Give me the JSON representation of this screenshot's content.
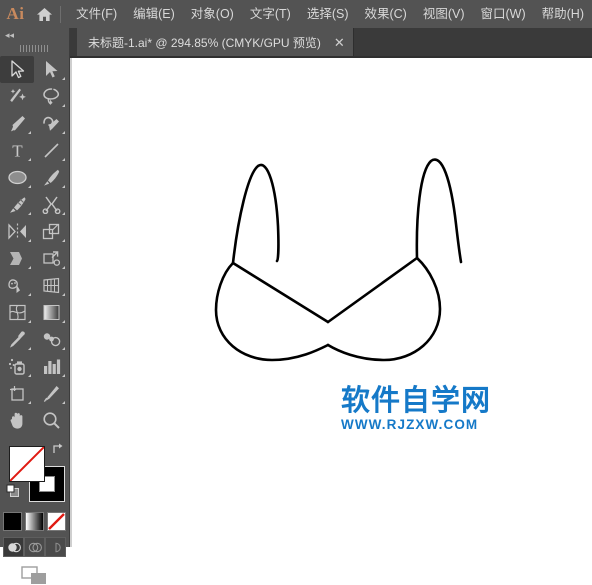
{
  "app": {
    "logo": "Ai",
    "home_icon": "home-icon"
  },
  "menubar": {
    "items": [
      {
        "label": "文件(F)",
        "name": "menu-file"
      },
      {
        "label": "编辑(E)",
        "name": "menu-edit"
      },
      {
        "label": "对象(O)",
        "name": "menu-object"
      },
      {
        "label": "文字(T)",
        "name": "menu-type"
      },
      {
        "label": "选择(S)",
        "name": "menu-select"
      },
      {
        "label": "效果(C)",
        "name": "menu-effect"
      },
      {
        "label": "视图(V)",
        "name": "menu-view"
      },
      {
        "label": "窗口(W)",
        "name": "menu-window"
      },
      {
        "label": "帮助(H)",
        "name": "menu-help"
      }
    ]
  },
  "tabbar": {
    "document_tab": {
      "title": "未标题-1.ai* @ 294.85% (CMYK/GPU 预览)",
      "close": "✕"
    }
  },
  "toolpanel": {
    "collapse": "◂◂",
    "tools": [
      {
        "name": "selection-tool",
        "title": "选择工具",
        "active": true
      },
      {
        "name": "direct-selection-tool",
        "title": "直接选择工具",
        "active": false
      },
      {
        "name": "magic-wand-tool",
        "title": "魔棒工具",
        "active": false
      },
      {
        "name": "lasso-tool",
        "title": "套索工具",
        "active": false
      },
      {
        "name": "pen-tool",
        "title": "钢笔工具",
        "active": false
      },
      {
        "name": "curvature-tool",
        "title": "曲率工具",
        "active": false
      },
      {
        "name": "type-tool",
        "title": "文字工具",
        "active": false
      },
      {
        "name": "line-segment-tool",
        "title": "直线段工具",
        "active": false
      },
      {
        "name": "ellipse-tool",
        "title": "椭圆工具",
        "active": false
      },
      {
        "name": "paintbrush-tool",
        "title": "画笔工具",
        "active": false
      },
      {
        "name": "blob-brush-tool",
        "title": "斑点画笔工具",
        "active": false
      },
      {
        "name": "eraser-tool",
        "title": "橡皮擦工具",
        "active": false
      },
      {
        "name": "rotate-tool",
        "title": "旋转工具",
        "active": false
      },
      {
        "name": "scale-tool",
        "title": "比例缩放工具",
        "active": false
      },
      {
        "name": "width-tool",
        "title": "宽度工具",
        "active": false
      },
      {
        "name": "free-transform-tool",
        "title": "自由变换工具",
        "active": false
      },
      {
        "name": "shape-builder-tool",
        "title": "形状生成器工具",
        "active": false
      },
      {
        "name": "perspective-grid-tool",
        "title": "透视网格工具",
        "active": false
      },
      {
        "name": "mesh-tool",
        "title": "网格工具",
        "active": false
      },
      {
        "name": "gradient-tool",
        "title": "渐变工具",
        "active": false
      },
      {
        "name": "eyedropper-tool",
        "title": "吸管工具",
        "active": false
      },
      {
        "name": "blend-tool",
        "title": "混合工具",
        "active": false
      },
      {
        "name": "symbol-sprayer-tool",
        "title": "符号喷枪工具",
        "active": false
      },
      {
        "name": "column-graph-tool",
        "title": "柱形图工具",
        "active": false
      },
      {
        "name": "artboard-tool",
        "title": "画板工具",
        "active": false
      },
      {
        "name": "slice-tool",
        "title": "切片工具",
        "active": false
      },
      {
        "name": "hand-tool",
        "title": "抓手工具",
        "active": false
      },
      {
        "name": "zoom-tool",
        "title": "缩放工具",
        "active": false
      }
    ],
    "fill_stroke": {
      "fill_label": "填色",
      "fill_color": "none",
      "stroke_label": "描边",
      "stroke_color": "#000000",
      "swap_label": "互换填色和描边",
      "default_label": "默认填色和描边"
    },
    "color_modes": [
      {
        "name": "color-mode-button",
        "label": "颜色",
        "color": "#000000",
        "active": false
      },
      {
        "name": "gradient-mode-button",
        "label": "渐变",
        "color": "#808080",
        "active": false
      },
      {
        "name": "none-mode-button",
        "label": "无",
        "color": "#ffffff",
        "active": true
      }
    ],
    "draw_modes": [
      {
        "name": "draw-normal-button",
        "label": "正常绘图",
        "active": true
      },
      {
        "name": "draw-behind-button",
        "label": "背面绘图",
        "active": false
      },
      {
        "name": "draw-inside-button",
        "label": "内部绘图",
        "active": false
      }
    ],
    "screen_mode": {
      "name": "screen-mode-button",
      "label": "更改屏幕模式"
    }
  },
  "canvas": {
    "artwork_name": "bra-line-drawing",
    "stroke_color": "#000000",
    "fill_color": "none",
    "background": "#ffffff"
  },
  "watermark": {
    "chinese": "软件自学网",
    "url": "WWW.RJZXW.COM",
    "color": "#1579c8"
  }
}
